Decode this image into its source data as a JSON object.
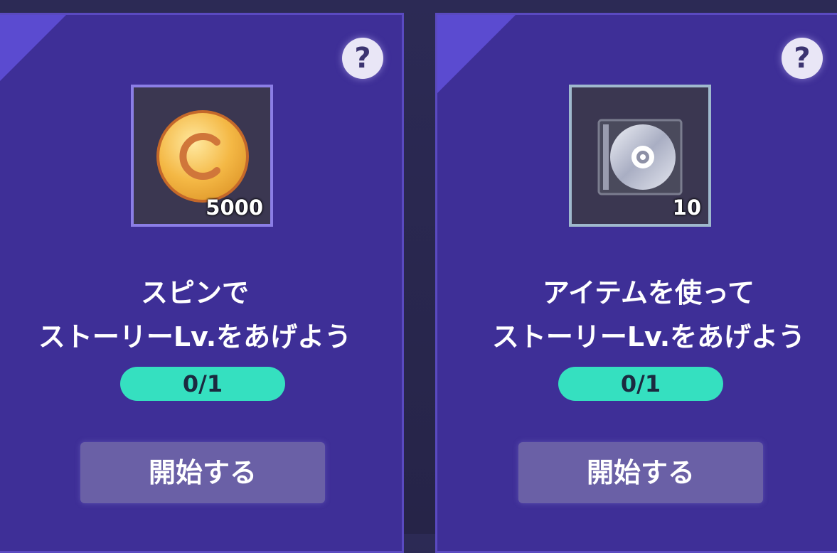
{
  "cards": [
    {
      "help_label": "?",
      "item_icon": "coin-icon",
      "item_quantity": "5000",
      "title_line1": "スピンで",
      "title_line2": "ストーリーLv.をあげよう",
      "progress": "0/1",
      "button_label": "開始する"
    },
    {
      "help_label": "?",
      "item_icon": "cd-case-icon",
      "item_quantity": "10",
      "title_line1": "アイテムを使って",
      "title_line2": "ストーリーLv.をあげよう",
      "progress": "0/1",
      "button_label": "開始する"
    }
  ],
  "colors": {
    "card_bg": "#3e2f97",
    "progress_pill": "#35e0c0",
    "button_bg": "#6a60a6",
    "coin": "#f0b040"
  }
}
